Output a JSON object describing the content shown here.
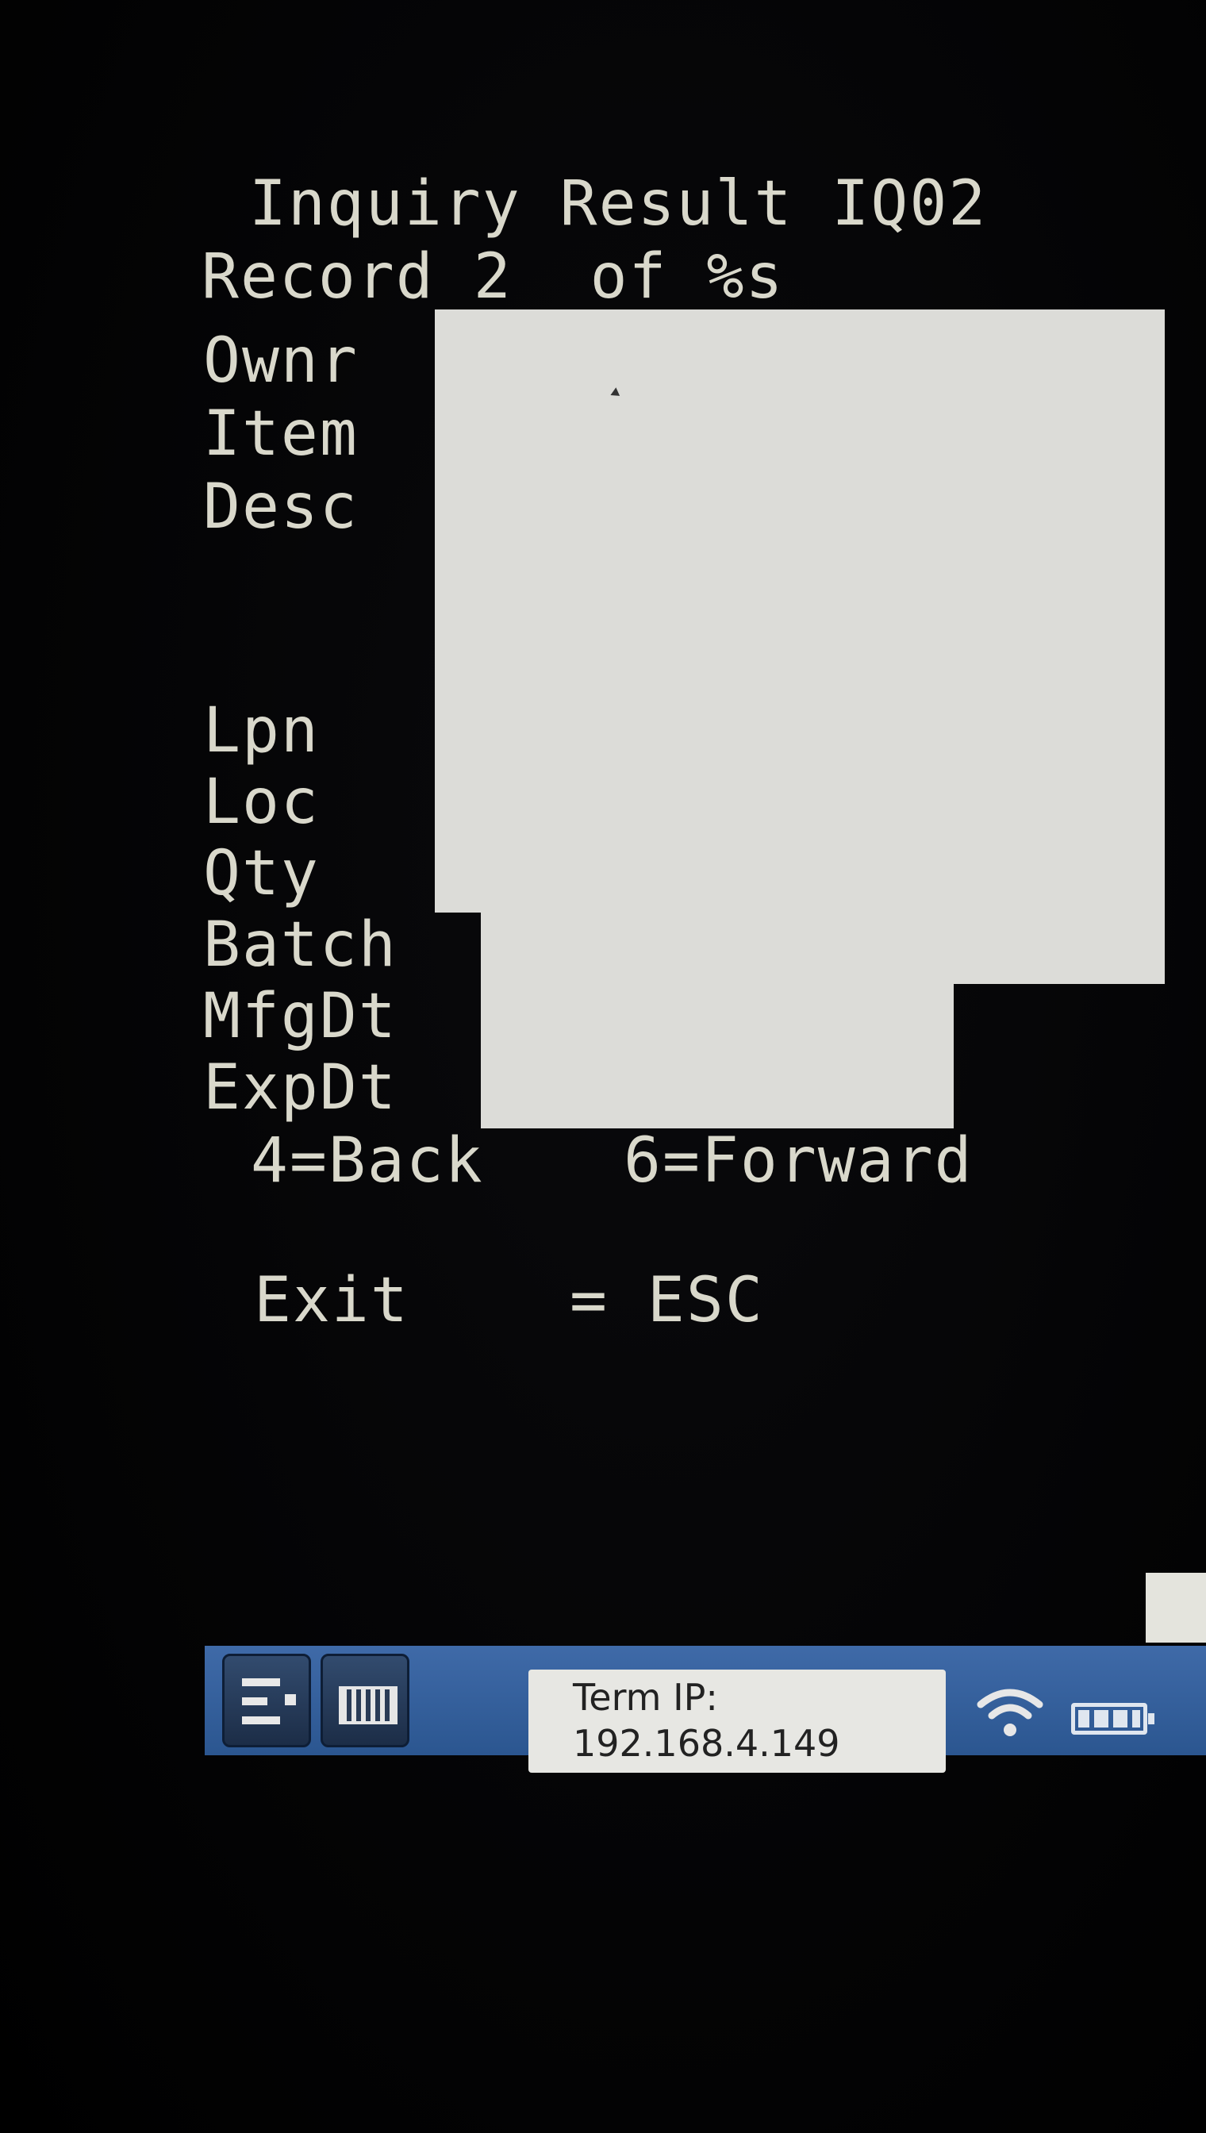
{
  "screen": {
    "title": "Inquiry Result IQ02",
    "record": "Record 2  of %s"
  },
  "fields": {
    "ownr": "Ownr",
    "item": "Item",
    "desc": "Desc",
    "lpn": "Lpn",
    "loc": "Loc",
    "qty": "Qty",
    "batch": "Batch",
    "mfgdt": "MfgDt",
    "expdt": "ExpDt"
  },
  "navigation": {
    "back": "4=Back",
    "forward": "6=Forward",
    "exit_label": "Exit",
    "exit_key": "= ESC"
  },
  "taskbar": {
    "term_ip_label": "Term IP:",
    "term_ip_value": "192.168.4.149",
    "icons": [
      "menu-icon",
      "keyboard-icon",
      "wifi-icon",
      "battery-icon"
    ]
  }
}
